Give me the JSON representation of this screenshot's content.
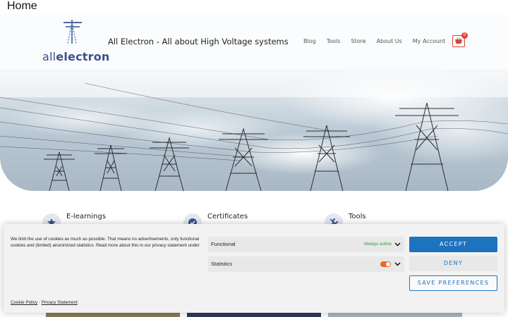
{
  "page": {
    "heading": "Home"
  },
  "header": {
    "logo_text_light": "all",
    "logo_text_bold": "electron",
    "site_title": "All Electron - All about High Voltage systems",
    "nav": [
      "Blog",
      "Tools",
      "Store",
      "About Us",
      "My Account"
    ],
    "cart_count": "0",
    "cart_icon": "shopping-basket-icon"
  },
  "features": [
    {
      "title": "E-learnings",
      "icon": "star-icon"
    },
    {
      "title": "Certificates",
      "icon": "check-badge-icon"
    },
    {
      "title": "Tools",
      "icon": "wrench-icon"
    }
  ],
  "cookie_banner": {
    "text": "We limit the use of cookies as much as possible. That means no advertisements, only functional cookies and (limited) anonimized statistics. Read more about this in our privacy statement under",
    "categories": [
      {
        "name": "Functional",
        "status": "Always active"
      },
      {
        "name": "Statistics",
        "toggle": "on"
      }
    ],
    "accept_label": "ACCEPT",
    "deny_label": "DENY",
    "save_label": "SAVE PREFERENCES",
    "links": {
      "cookie_policy": "Cookie Policy",
      "separator": "·",
      "privacy": "Privacy Statement"
    }
  },
  "colors": {
    "accent": "#1e73be",
    "cart": "#d9453b",
    "toggle_on": "#e96a1f",
    "active_green": "#2f9a3b",
    "logo": "#3c4f8e"
  }
}
